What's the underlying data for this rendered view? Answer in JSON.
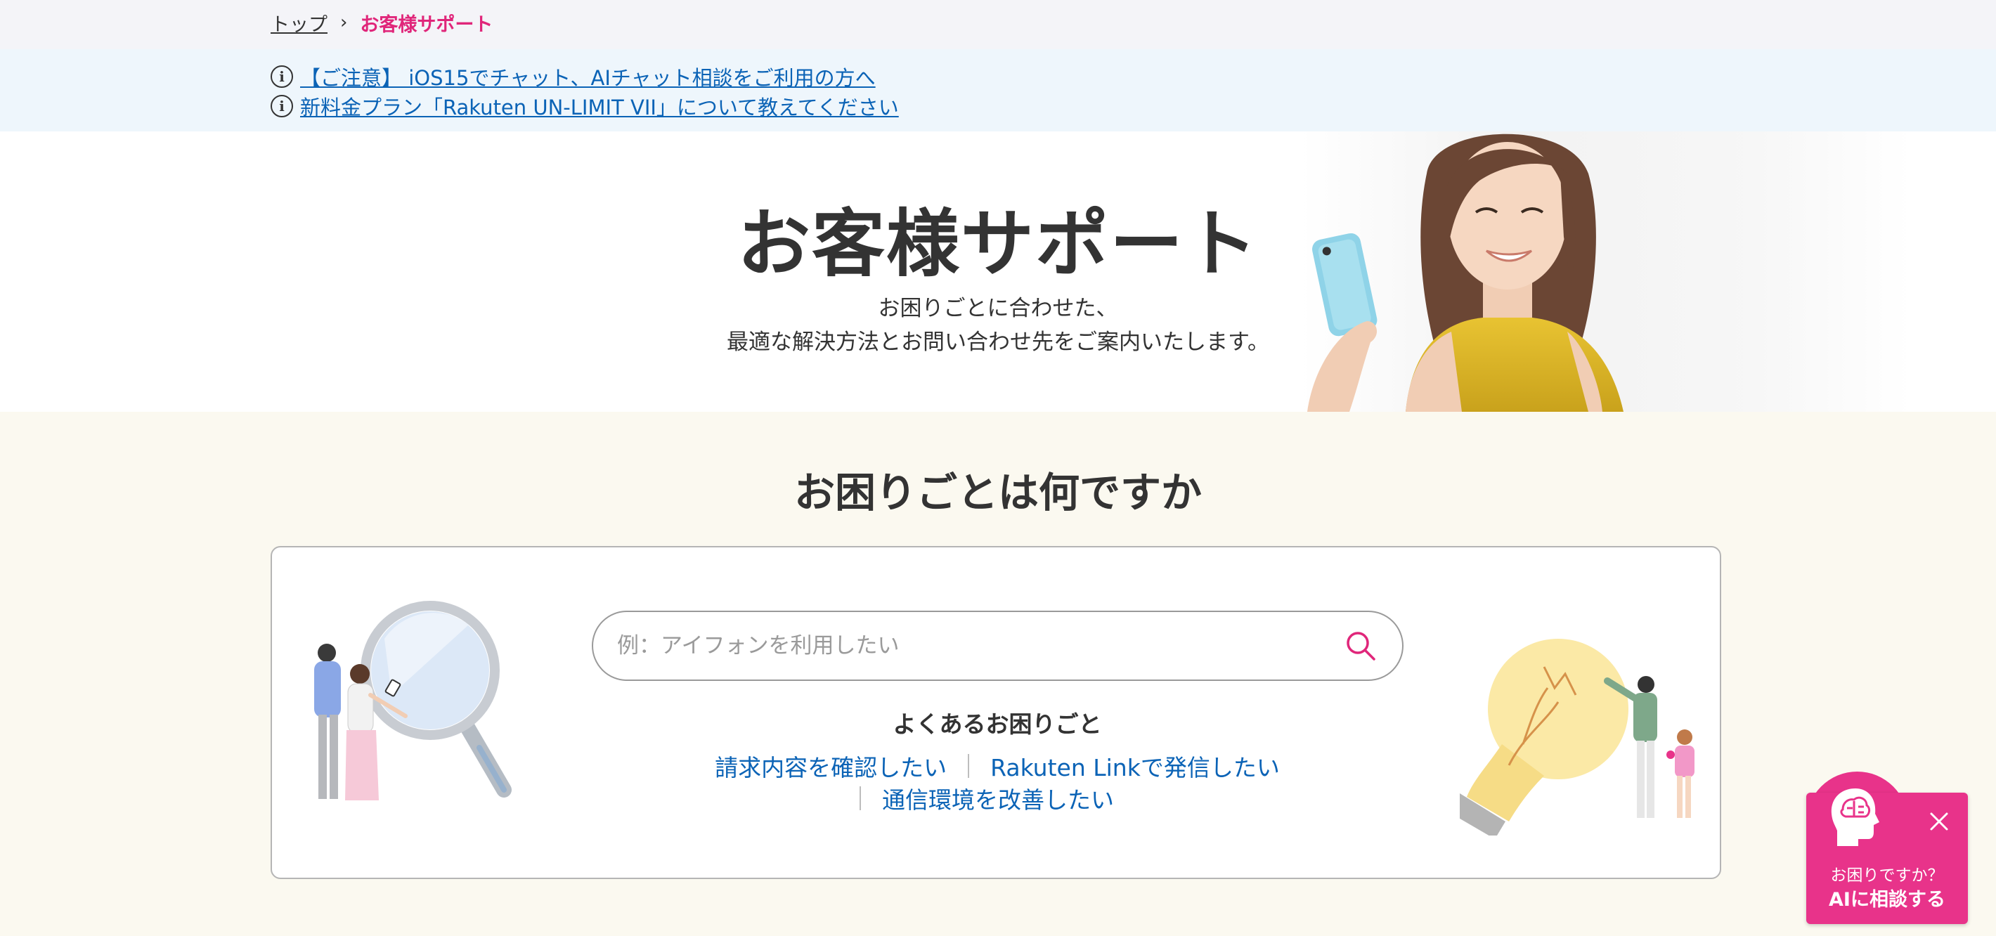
{
  "breadcrumb": {
    "home": "トップ",
    "separator": "›",
    "current": "お客様サポート"
  },
  "notices": [
    {
      "icon": "info-icon",
      "text": "【ご注意】 iOS15でチャット、AIチャット相談をご利用の方へ"
    },
    {
      "icon": "info-icon",
      "text": "新料金プラン「Rakuten UN-LIMIT VII」について教えてください"
    }
  ],
  "hero": {
    "title": "お客様サポート",
    "desc_line1": "お困りごとに合わせた、",
    "desc_line2": "最適な解決方法とお問い合わせ先をご案内いたします。"
  },
  "search_section": {
    "title": "お困りごとは何ですか",
    "placeholder": "例：アイフォンを利用したい",
    "search_icon": "search-icon",
    "faq_heading": "よくあるお困りごと",
    "faq_links": [
      "請求内容を確認したい",
      "Rakuten Linkで発信したい",
      "通信環境を改善したい"
    ]
  },
  "ai_widget": {
    "line1": "お困りですか？",
    "line2": "AIに相談する",
    "close_icon": "close-icon",
    "brain_icon": "ai-brain-icon"
  },
  "colors": {
    "accent": "#e0267a",
    "link": "#0b63b6",
    "widget": "#e8338a",
    "notice_bg": "#eef6fc",
    "section_bg": "#fbf9f0"
  }
}
